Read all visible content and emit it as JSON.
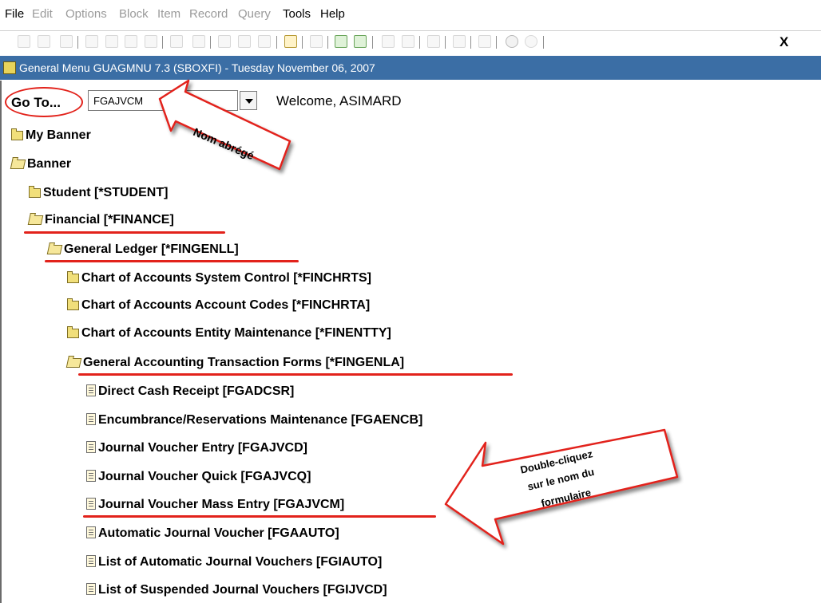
{
  "menu": [
    "File",
    "Edit",
    "Options",
    "Block",
    "Item",
    "Record",
    "Query",
    "Tools",
    "Help"
  ],
  "toolbar": {
    "exit_label": "X"
  },
  "window": {
    "title": "General Menu  GUAGMNU  7.3  (SBOXFI) - Tuesday November 06, 2007"
  },
  "goto": {
    "label": "Go To...",
    "value": "FGAJVCM"
  },
  "welcome": "Welcome, ASIMARD",
  "tree": [
    "My Banner",
    "Banner",
    "Student [*STUDENT]",
    "Financial [*FINANCE]",
    "General Ledger [*FINGENLL]",
    "Chart of Accounts System Control [*FINCHRTS]",
    "Chart of Accounts Account Codes [*FINCHRTA]",
    "Chart of Accounts Entity Maintenance [*FINENTTY]",
    "General Accounting Transaction Forms [*FINGENLA]",
    "Direct Cash Receipt [FGADCSR]",
    "Encumbrance/Reservations Maintenance [FGAENCB]",
    "Journal Voucher Entry [FGAJVCD]",
    "Journal Voucher Quick [FGAJVCQ]",
    "Journal Voucher Mass Entry [FGAJVCM]",
    "Automatic Journal Voucher [FGAAUTO]",
    "List of Automatic Journal Vouchers [FGIAUTO]",
    "List of Suspended Journal Vouchers [FGIJVCD]"
  ],
  "annotations": {
    "short_name": "Nom abrégé",
    "double_click": [
      "Double-cliquez",
      "sur le nom du",
      "formulaire"
    ]
  },
  "colors": {
    "title_bar": "#3b6ea5",
    "annotation_red": "#e2221b"
  }
}
